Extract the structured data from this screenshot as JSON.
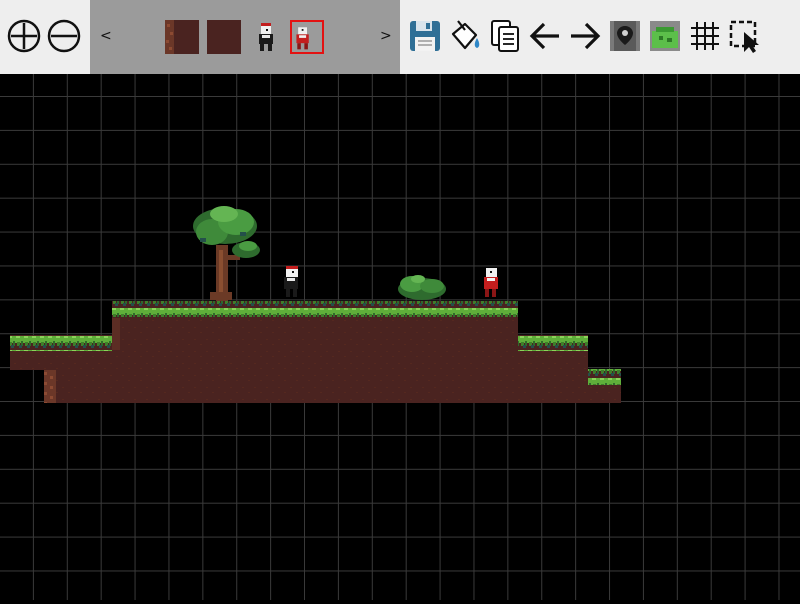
{
  "toolbar": {
    "zoom_in": "zoom-in-icon",
    "zoom_out": "zoom-out-icon",
    "save": "save-icon",
    "fill": "fill-bucket-icon",
    "copy": "copy-icon",
    "undo": "arrow-left-icon",
    "redo": "arrow-right-icon",
    "spawn": "spawn-point-icon",
    "background": "background-icon",
    "grid": "grid-icon",
    "select": "select-icon"
  },
  "palette": {
    "prev_label": "<",
    "next_label": ">",
    "items": [
      {
        "name": "dirt-edge-tile",
        "selected": false
      },
      {
        "name": "dirt-tile",
        "selected": false
      },
      {
        "name": "npc-dark-character",
        "selected": false
      },
      {
        "name": "npc-red-character",
        "selected": true
      }
    ]
  },
  "colors": {
    "toolbar_bg": "#eeeeee",
    "palette_bg": "#9b9b9b",
    "selection": "#e31212",
    "grass": "#5fae3a",
    "dirt": "#4a2320",
    "grid_line": "#3a3a3a"
  }
}
